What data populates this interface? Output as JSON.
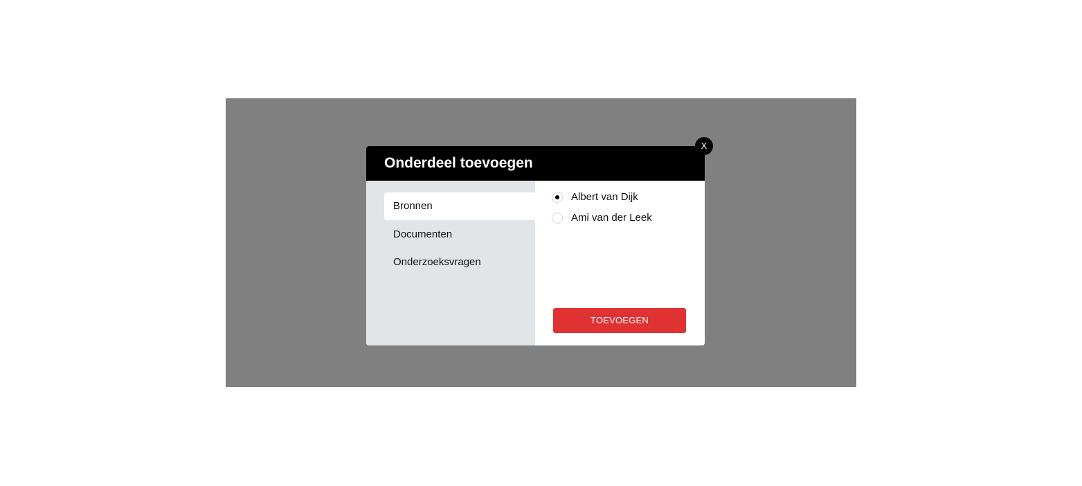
{
  "modal": {
    "title": "Onderdeel toevoegen",
    "close_label": "X"
  },
  "sidebar": {
    "items": [
      {
        "label": "Bronnen",
        "active": true
      },
      {
        "label": "Documenten",
        "active": false
      },
      {
        "label": "Onderzoeksvragen",
        "active": false
      }
    ]
  },
  "options": [
    {
      "label": "Albert van Dijk",
      "selected": true
    },
    {
      "label": "Ami van der Leek",
      "selected": false
    }
  ],
  "actions": {
    "add_label": "TOEVOEGEN"
  },
  "colors": {
    "overlay": "#808080",
    "header": "#000000",
    "sidebar": "#e1e5e8",
    "accent": "#e03232"
  }
}
